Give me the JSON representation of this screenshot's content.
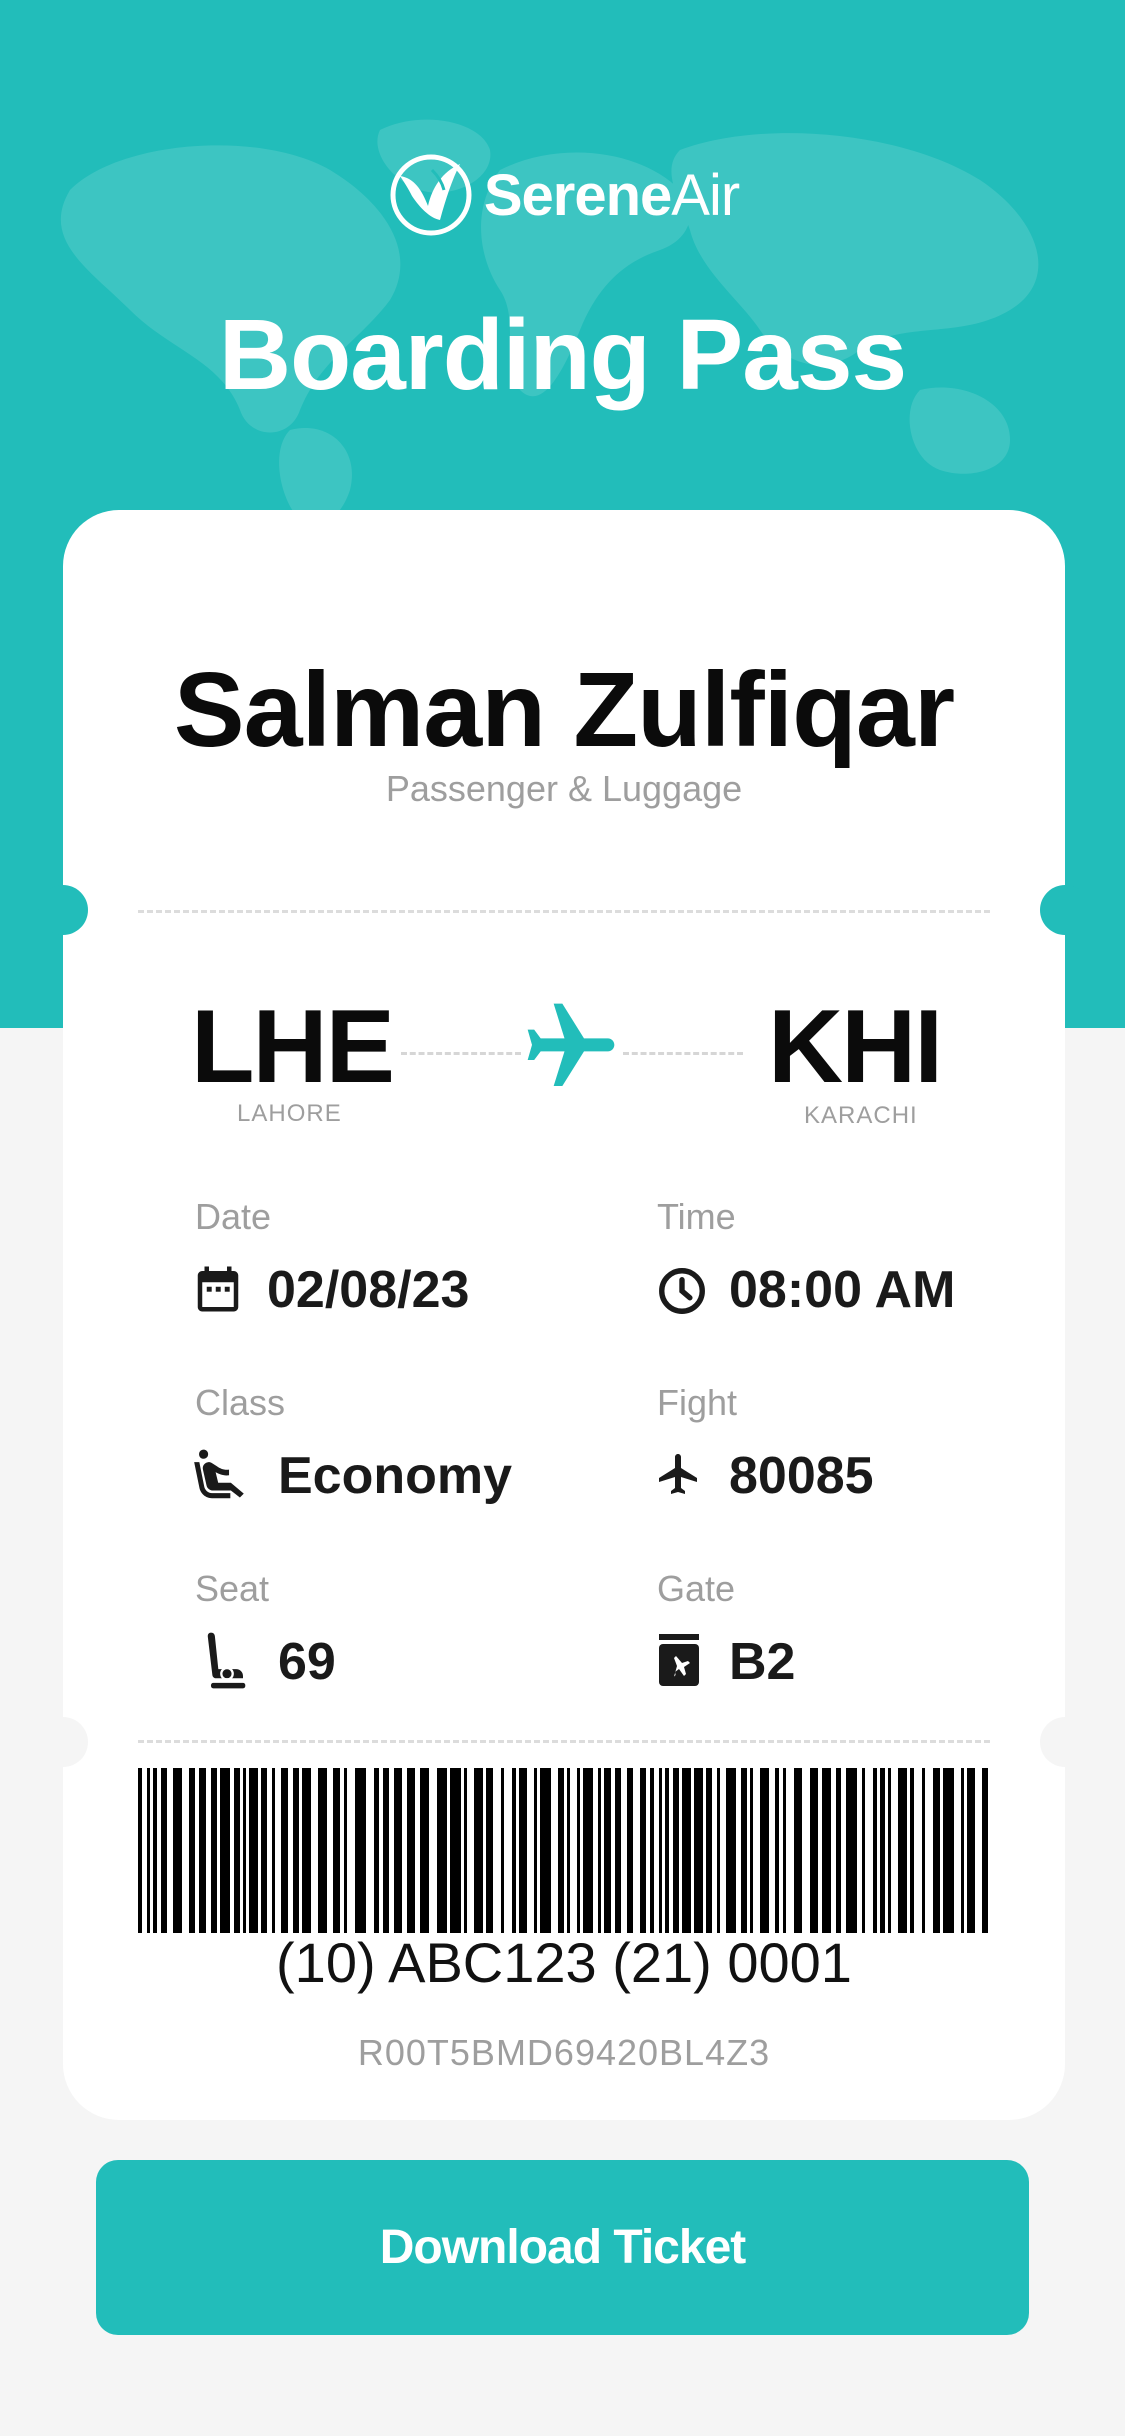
{
  "app": {
    "brand_primary": "Serene",
    "brand_secondary": "Air",
    "accent_color": "#22bdba"
  },
  "header": {
    "title": "Boarding Pass"
  },
  "passenger": {
    "name": "Salman Zulfiqar",
    "subtitle": "Passenger & Luggage"
  },
  "route": {
    "from_code": "LHE",
    "from_city": "LAHORE",
    "to_code": "KHI",
    "to_city": "KARACHI",
    "icon": "airplane-icon"
  },
  "fields": {
    "date": {
      "label": "Date",
      "value": "02/08/23",
      "icon": "calendar-icon"
    },
    "time": {
      "label": "Time",
      "value": "08:00 AM",
      "icon": "clock-icon"
    },
    "class": {
      "label": "Class",
      "value": "Economy",
      "icon": "passenger-seated-icon"
    },
    "flight": {
      "label": "Fight",
      "value": "80085",
      "icon": "plane-icon"
    },
    "seat": {
      "label": "Seat",
      "value": "69",
      "icon": "seat-icon"
    },
    "gate": {
      "label": "Gate",
      "value": "B2",
      "icon": "gate-icon"
    }
  },
  "barcode": {
    "text": "(10) ABC123 (21) 0001",
    "ticket_code": "R00T5BMD69420BL4Z3"
  },
  "actions": {
    "download_label": "Download Ticket"
  }
}
